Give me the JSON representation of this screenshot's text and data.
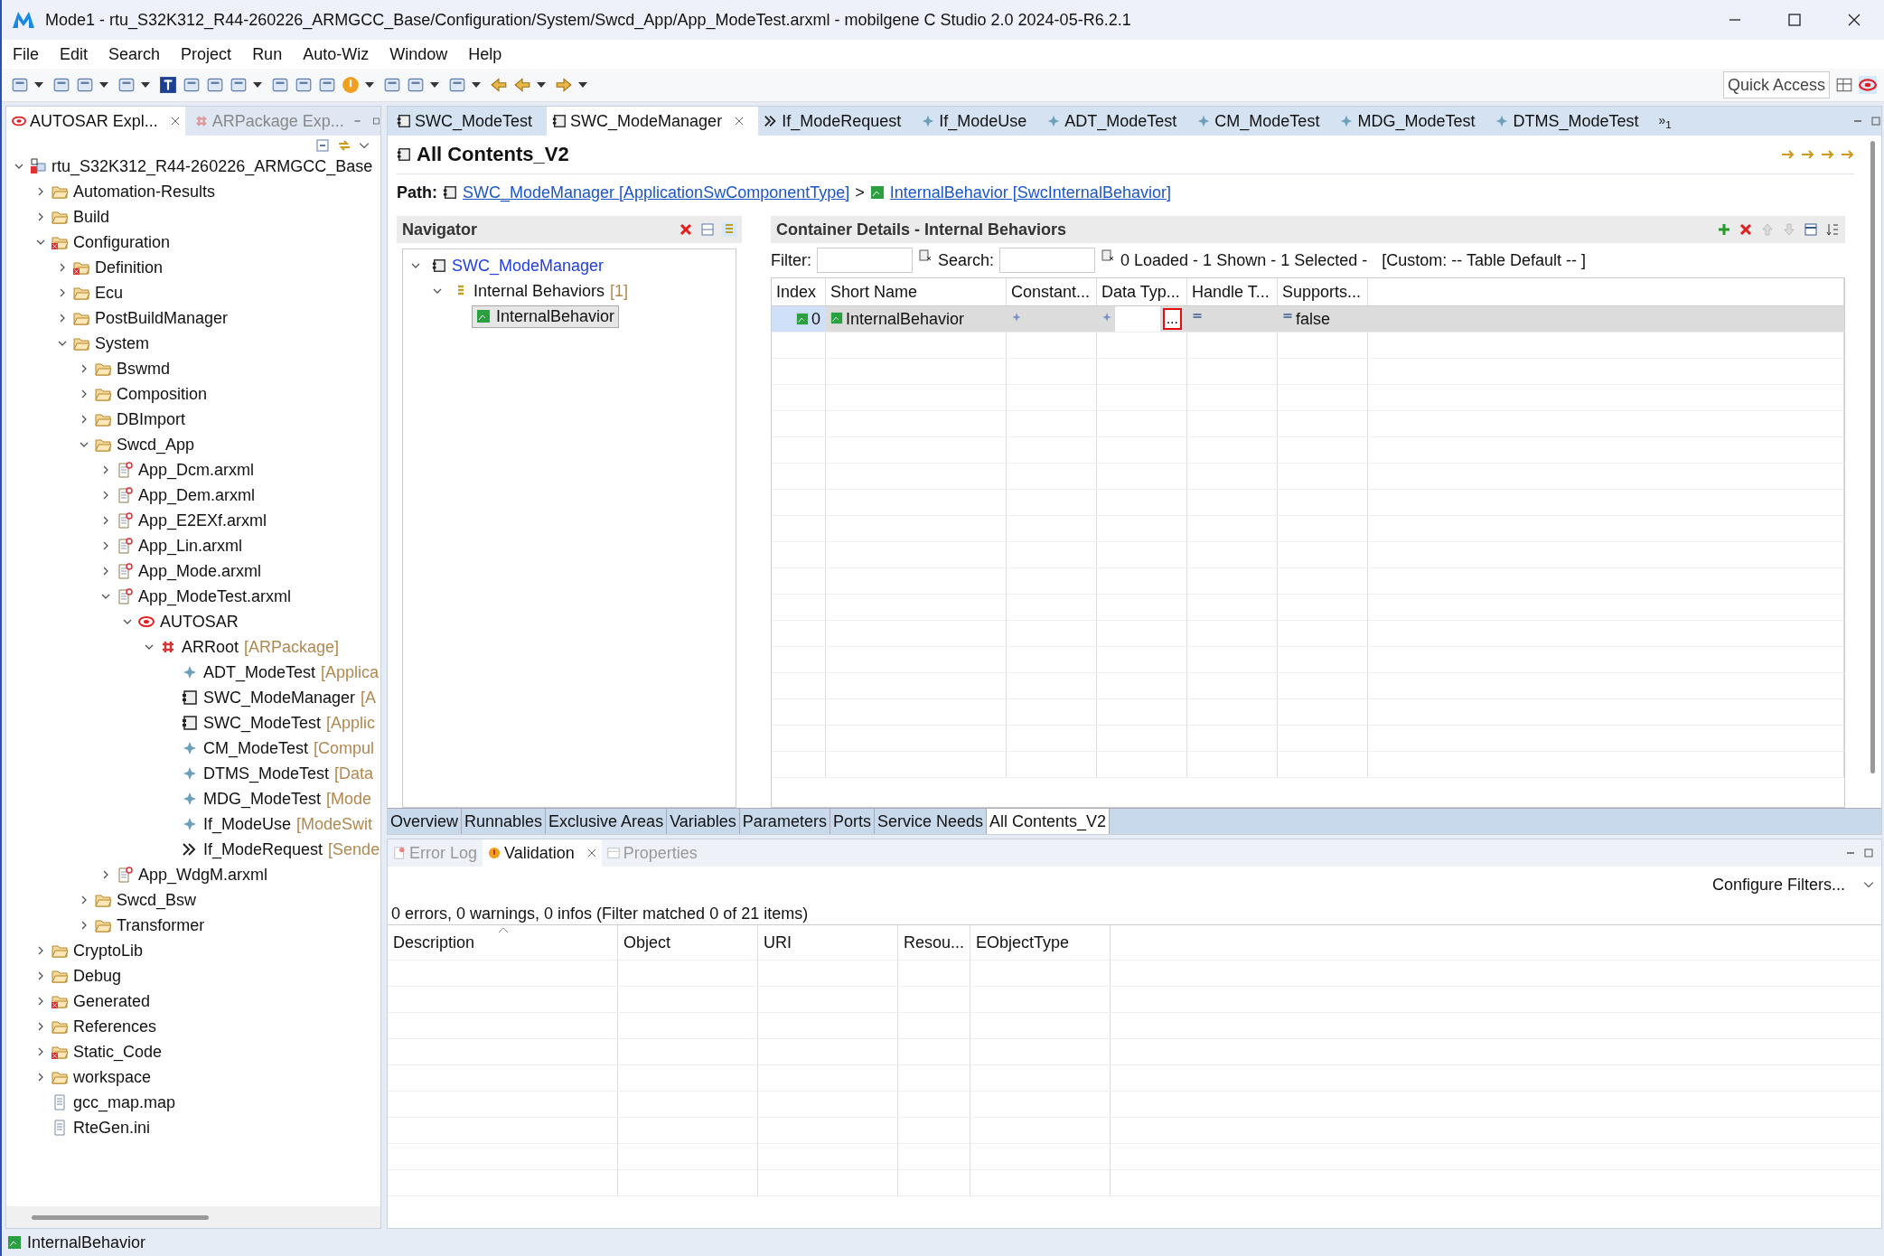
{
  "window": {
    "title": "Mode1 - rtu_S32K312_R44-260226_ARMGCC_Base/Configuration/System/Swcd_App/App_ModeTest.arxml - mobilgene C Studio 2.0 2024-05-R6.2.1"
  },
  "menu": [
    "File",
    "Edit",
    "Search",
    "Project",
    "Run",
    "Auto-Wiz",
    "Window",
    "Help"
  ],
  "quick_access": {
    "placeholder": "Quick Access"
  },
  "explorer": {
    "tabs": [
      {
        "label": "AUTOSAR Expl...",
        "selected": true
      },
      {
        "label": "ARPackage Exp...",
        "selected": false
      }
    ],
    "tree": [
      {
        "label": "rtu_S32K312_R44-260226_ARMGCC_Base",
        "kind": "project",
        "expanded": true,
        "children": [
          {
            "label": "Automation-Results",
            "kind": "folder",
            "expanded": false
          },
          {
            "label": "Build",
            "kind": "folder",
            "expanded": false
          },
          {
            "label": "Configuration",
            "kind": "folder-error",
            "expanded": true,
            "children": [
              {
                "label": "Definition",
                "kind": "folder-error",
                "expanded": false
              },
              {
                "label": "Ecu",
                "kind": "folder",
                "expanded": false
              },
              {
                "label": "PostBuildManager",
                "kind": "folder",
                "expanded": false
              },
              {
                "label": "System",
                "kind": "folder",
                "expanded": true,
                "children": [
                  {
                    "label": "Bswmd",
                    "kind": "folder",
                    "expanded": false
                  },
                  {
                    "label": "Composition",
                    "kind": "folder",
                    "expanded": false
                  },
                  {
                    "label": "DBImport",
                    "kind": "folder",
                    "expanded": false
                  },
                  {
                    "label": "Swcd_App",
                    "kind": "folder",
                    "expanded": true,
                    "children": [
                      {
                        "label": "App_Dcm.arxml",
                        "kind": "arxml",
                        "expanded": false
                      },
                      {
                        "label": "App_Dem.arxml",
                        "kind": "arxml",
                        "expanded": false
                      },
                      {
                        "label": "App_E2EXf.arxml",
                        "kind": "arxml",
                        "expanded": false
                      },
                      {
                        "label": "App_Lin.arxml",
                        "kind": "arxml",
                        "expanded": false
                      },
                      {
                        "label": "App_Mode.arxml",
                        "kind": "arxml",
                        "expanded": false
                      },
                      {
                        "label": "App_ModeTest.arxml",
                        "kind": "arxml",
                        "expanded": true,
                        "children": [
                          {
                            "label": "AUTOSAR",
                            "kind": "autosar",
                            "expanded": true,
                            "children": [
                              {
                                "label": "ARRoot",
                                "type": "[ARPackage]",
                                "kind": "package",
                                "expanded": true,
                                "children": [
                                  {
                                    "label": "ADT_ModeTest",
                                    "type": "[Applica",
                                    "kind": "element"
                                  },
                                  {
                                    "label": "SWC_ModeManager",
                                    "type": "[A",
                                    "kind": "component"
                                  },
                                  {
                                    "label": "SWC_ModeTest",
                                    "type": "[Applic",
                                    "kind": "component"
                                  },
                                  {
                                    "label": "CM_ModeTest",
                                    "type": "[Compul",
                                    "kind": "element"
                                  },
                                  {
                                    "label": "DTMS_ModeTest",
                                    "type": "[Data",
                                    "kind": "element"
                                  },
                                  {
                                    "label": "MDG_ModeTest",
                                    "type": "[Mode",
                                    "kind": "element"
                                  },
                                  {
                                    "label": "If_ModeUse",
                                    "type": "[ModeSwit",
                                    "kind": "element"
                                  },
                                  {
                                    "label": "If_ModeRequest",
                                    "type": "[Sende",
                                    "kind": "interface"
                                  }
                                ]
                              }
                            ]
                          }
                        ]
                      },
                      {
                        "label": "App_WdgM.arxml",
                        "kind": "arxml",
                        "expanded": false
                      }
                    ]
                  },
                  {
                    "label": "Swcd_Bsw",
                    "kind": "folder",
                    "expanded": false
                  },
                  {
                    "label": "Transformer",
                    "kind": "folder",
                    "expanded": false
                  }
                ]
              }
            ]
          },
          {
            "label": "CryptoLib",
            "kind": "folder",
            "expanded": false
          },
          {
            "label": "Debug",
            "kind": "folder",
            "expanded": false
          },
          {
            "label": "Generated",
            "kind": "folder-error",
            "expanded": false
          },
          {
            "label": "References",
            "kind": "folder",
            "expanded": false
          },
          {
            "label": "Static_Code",
            "kind": "folder-error",
            "expanded": false
          },
          {
            "label": "workspace",
            "kind": "folder",
            "expanded": false
          },
          {
            "label": "gcc_map.map",
            "kind": "file"
          },
          {
            "label": "RteGen.ini",
            "kind": "file"
          }
        ]
      }
    ]
  },
  "editor_tabs": [
    {
      "label": "SWC_ModeTest",
      "kind": "component",
      "selected": false
    },
    {
      "label": "SWC_ModeManager",
      "kind": "component",
      "selected": true
    },
    {
      "label": "If_ModeRequest",
      "kind": "interface",
      "selected": false
    },
    {
      "label": "If_ModeUse",
      "kind": "element",
      "selected": false
    },
    {
      "label": "ADT_ModeTest",
      "kind": "element",
      "selected": false
    },
    {
      "label": "CM_ModeTest",
      "kind": "element",
      "selected": false
    },
    {
      "label": "MDG_ModeTest",
      "kind": "element",
      "selected": false
    },
    {
      "label": "DTMS_ModeTest",
      "kind": "element",
      "selected": false
    }
  ],
  "more_tabs": {
    "label": "»",
    "count": "1"
  },
  "editor": {
    "title": "All Contents_V2",
    "path": {
      "label": "Path:",
      "links": [
        {
          "text": "SWC_ModeManager [ApplicationSwComponentType]",
          "kind": "component"
        },
        {
          "text": "InternalBehavior [SwcInternalBehavior]",
          "kind": "behavior"
        }
      ],
      "separator": ">"
    },
    "navigator": {
      "title": "Navigator",
      "tree": [
        {
          "label": "SWC_ModeManager",
          "kind": "component",
          "expanded": true,
          "selected": false,
          "children": [
            {
              "label": "Internal Behaviors",
              "count": "[1]",
              "kind": "list",
              "expanded": true,
              "selected": false,
              "children": [
                {
                  "label": "InternalBehavior",
                  "kind": "behavior",
                  "selected": true
                }
              ]
            }
          ]
        }
      ]
    },
    "details": {
      "title": "Container Details - Internal Behaviors",
      "filter_label": "Filter:",
      "search_label": "Search:",
      "summary": "0 Loaded - 1 Shown - 1 Selected -",
      "custom": "[Custom: -- Table Default -- ]",
      "columns": [
        "Index",
        "Short Name",
        "Constant...",
        "Data Typ...",
        "Handle T...",
        "Supports..."
      ],
      "rows": [
        {
          "index": "0",
          "short_name": "InternalBehavior",
          "browse_button": "...",
          "supports": "false",
          "selected": true
        }
      ]
    },
    "page_tabs": [
      {
        "label": "Overview",
        "selected": false
      },
      {
        "label": "Runnables",
        "selected": false
      },
      {
        "label": "Exclusive Areas",
        "selected": false
      },
      {
        "label": "Variables",
        "selected": false
      },
      {
        "label": "Parameters",
        "selected": false
      },
      {
        "label": "Ports",
        "selected": false
      },
      {
        "label": "Service Needs",
        "selected": false
      },
      {
        "label": "All Contents_V2",
        "selected": true
      }
    ]
  },
  "bottom_panel": {
    "tabs": [
      {
        "label": "Error Log",
        "kind": "log",
        "selected": false
      },
      {
        "label": "Validation",
        "kind": "validation",
        "selected": true
      },
      {
        "label": "Properties",
        "kind": "properties",
        "selected": false
      }
    ],
    "configure": "Configure Filters...",
    "summary": "0 errors, 0 warnings, 0 infos (Filter matched 0 of 21 items)",
    "columns": [
      "Description",
      "Object",
      "URI",
      "Resou...",
      "EObjectType"
    ]
  },
  "status_bar": {
    "text": "InternalBehavior"
  }
}
